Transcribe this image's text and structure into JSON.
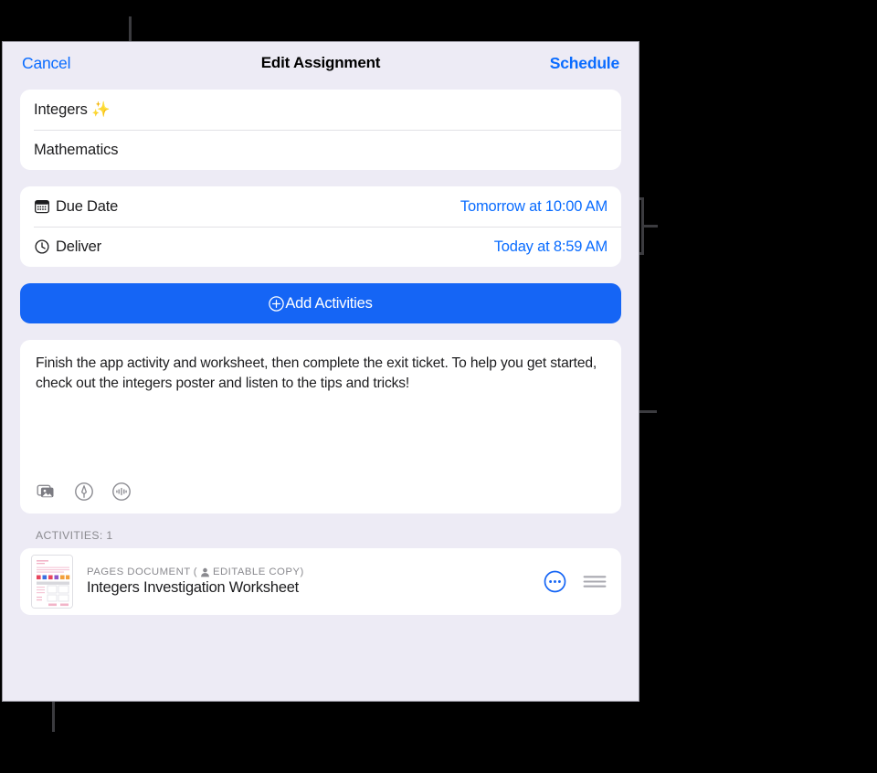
{
  "window": {
    "title": "Edit Assignment"
  },
  "navbar": {
    "cancel_label": "Cancel",
    "title": "Edit Assignment",
    "schedule_label": "Schedule"
  },
  "details": {
    "title_value": "Integers ✨",
    "subject_value": "Mathematics"
  },
  "dates": {
    "due": {
      "icon": "calendar-icon",
      "label": "Due Date",
      "value": "Tomorrow at 10:00 AM"
    },
    "deliver": {
      "icon": "clock-icon",
      "label": "Deliver",
      "value": "Today at 8:59 AM"
    }
  },
  "add_activities": {
    "icon": "plus-circle-icon",
    "label": "Add Activities"
  },
  "notes": {
    "text": "Finish the app activity and worksheet, then complete the exit ticket. To help you get started, check out the integers poster and listen to the tips and tricks!",
    "tools": [
      {
        "name": "photo-library-icon"
      },
      {
        "name": "markup-pen-icon"
      },
      {
        "name": "audio-recording-icon"
      }
    ]
  },
  "activities": {
    "section_label": "ACTIVITIES: 1",
    "items": [
      {
        "kind_prefix": "PAGES DOCUMENT",
        "kind_paren_open": "(",
        "kind_copy": "EDITABLE COPY)",
        "title": "Integers Investigation Worksheet",
        "more_icon": "more-circle-icon",
        "drag_icon": "reorder-handle-icon"
      }
    ]
  },
  "colors": {
    "accent_blue": "#0a6cff",
    "button_blue": "#1565f5",
    "panel_bg": "#edebf5",
    "card_bg": "#ffffff",
    "secondary_text": "#8a8a8f"
  }
}
